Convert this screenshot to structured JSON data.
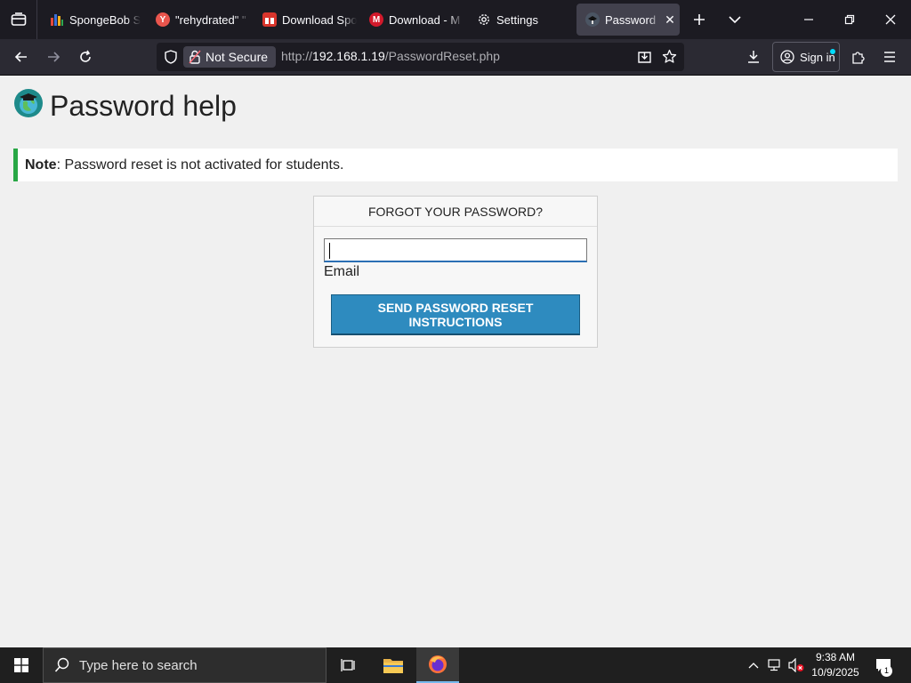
{
  "browser": {
    "tabs": [
      {
        "title": "SpongeBob Sc",
        "favicon": "bars-icon",
        "color": "#3a6fd8"
      },
      {
        "title": "\"rehydrated\" \"",
        "favicon": "Y",
        "color": "#e9554d"
      },
      {
        "title": "Download Spo",
        "favicon": "gift-icon",
        "color": "#d9352c"
      },
      {
        "title": "Download - M",
        "favicon": "M",
        "color": "#d2192b"
      },
      {
        "title": "Settings",
        "favicon": "gear-icon",
        "color": ""
      },
      {
        "title": "Password he",
        "favicon": "school-logo-icon",
        "color": "#3a3f4a",
        "active": true
      }
    ],
    "security_label": "Not Secure",
    "url_prefix": "http://",
    "url_host": "192.168.1.19",
    "url_path": "/PasswordReset.php",
    "signin_label": "Sign in"
  },
  "page": {
    "title": "Password help",
    "note_label": "Note",
    "note_text": ": Password reset is not activated for students.",
    "card": {
      "header": "FORGOT YOUR PASSWORD?",
      "email_value": "",
      "email_label": "Email",
      "submit_label": "SEND PASSWORD RESET INSTRUCTIONS"
    }
  },
  "taskbar": {
    "search_placeholder": "Type here to search",
    "time": "9:38 AM",
    "date": "10/9/2025",
    "notification_count": "1"
  },
  "colors": {
    "accent_button": "#2e8bbf",
    "note_border": "#28a745",
    "tabbar_bg": "#1c1b22",
    "navbar_bg": "#2b2a33"
  }
}
